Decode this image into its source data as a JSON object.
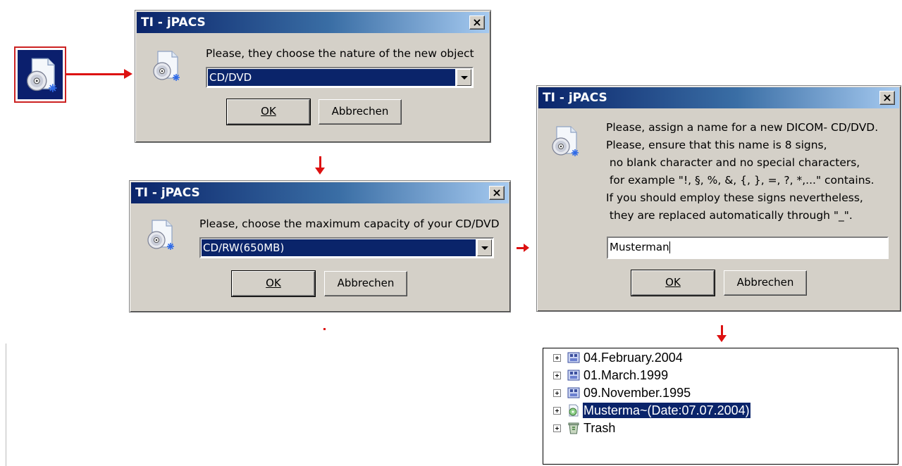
{
  "colors": {
    "arrow": "#dd1111",
    "titlebar_start": "#0a246a",
    "titlebar_end": "#a6caf0",
    "dialog_face": "#d4d0c8",
    "selection": "#0a246a"
  },
  "start_icon": {
    "icon": "cd-new-object-icon"
  },
  "dialog1": {
    "title": "TI - jPACS",
    "close": "×",
    "prompt": "Please, they choose the nature of the new object",
    "select_value": "CD/DVD",
    "ok": "OK",
    "cancel": "Abbrechen"
  },
  "dialog2": {
    "title": "TI - jPACS",
    "close": "×",
    "prompt": "Please, choose the maximum capacity of your CD/DVD",
    "select_value": "CD/RW(650MB)",
    "ok": "OK",
    "cancel": "Abbrechen"
  },
  "dialog3": {
    "title": "TI - jPACS",
    "close": "×",
    "lines": [
      "Please, assign a name for a new DICOM- CD/DVD.",
      "Please, ensure that this name is 8 signs,",
      " no blank character and no special characters,",
      " for example \"!, §, %, &, {, }, =, ?, *,...\" contains.",
      "If you should employ these signs nevertheless,",
      " they are replaced automatically through \"_\"."
    ],
    "input_value": "Musterman",
    "ok": "OK",
    "cancel": "Abbrechen"
  },
  "tree": {
    "items": [
      {
        "label": "04.February.2004",
        "icon": "dicom-study-icon",
        "selected": false
      },
      {
        "label": "01.March.1999",
        "icon": "dicom-study-icon",
        "selected": false
      },
      {
        "label": "09.November.1995",
        "icon": "dicom-study-icon",
        "selected": false
      },
      {
        "label": "Musterma~(Date:07.07.2004)",
        "icon": "cd-disc-icon",
        "selected": true
      },
      {
        "label": "Trash",
        "icon": "trash-icon",
        "selected": false
      }
    ]
  }
}
